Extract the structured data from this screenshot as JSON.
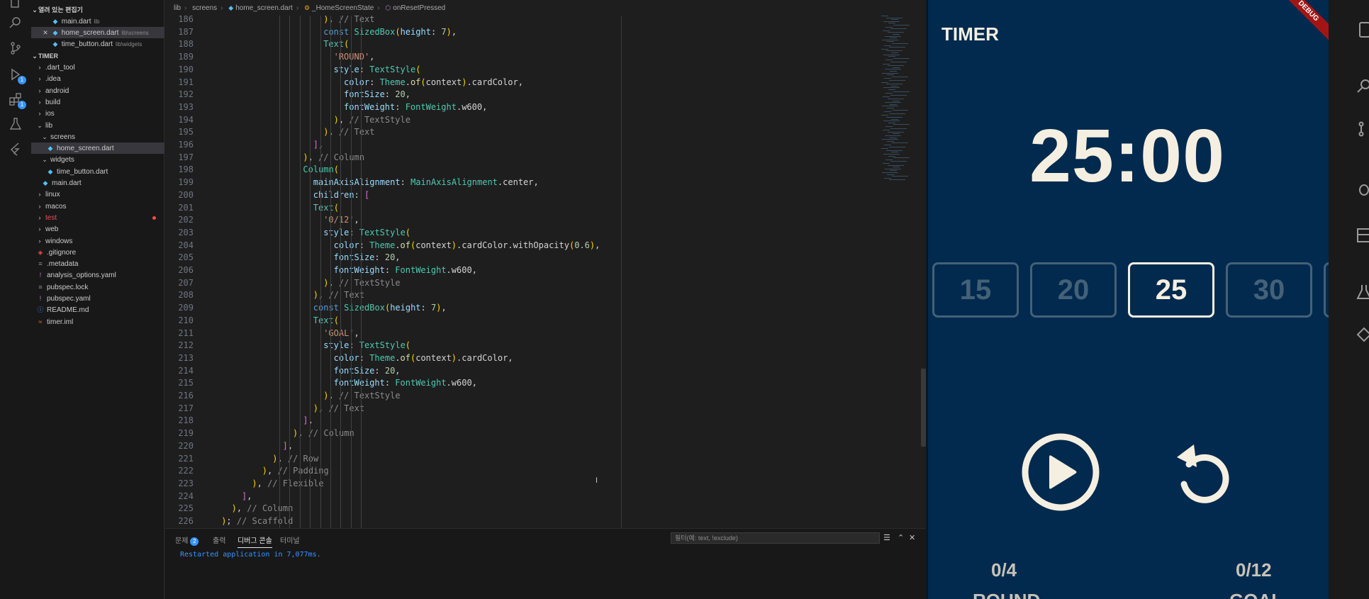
{
  "explorer": {
    "open_editors_title": "열려 있는 편집기",
    "open_editors": [
      {
        "name": "main.dart",
        "desc": "lib"
      },
      {
        "name": "home_screen.dart",
        "desc": "lib\\screens"
      },
      {
        "name": "time_button.dart",
        "desc": "lib\\widgets"
      }
    ],
    "project_title": "TIMER",
    "tree": [
      {
        "label": ".dart_tool",
        "kind": "folder",
        "depth": 1
      },
      {
        "label": ".idea",
        "kind": "folder",
        "depth": 1
      },
      {
        "label": "android",
        "kind": "folder",
        "depth": 1
      },
      {
        "label": "build",
        "kind": "folder",
        "depth": 1
      },
      {
        "label": "ios",
        "kind": "folder",
        "depth": 1
      },
      {
        "label": "lib",
        "kind": "folder-open",
        "depth": 1
      },
      {
        "label": "screens",
        "kind": "folder-open",
        "depth": 2
      },
      {
        "label": "home_screen.dart",
        "kind": "dart",
        "depth": 3
      },
      {
        "label": "widgets",
        "kind": "folder-open",
        "depth": 2
      },
      {
        "label": "time_button.dart",
        "kind": "dart",
        "depth": 3
      },
      {
        "label": "main.dart",
        "kind": "dart",
        "depth": 2
      },
      {
        "label": "linux",
        "kind": "folder",
        "depth": 1
      },
      {
        "label": "macos",
        "kind": "folder",
        "depth": 1
      },
      {
        "label": "test",
        "kind": "folder",
        "depth": 1
      },
      {
        "label": "web",
        "kind": "folder",
        "depth": 1
      },
      {
        "label": "windows",
        "kind": "folder",
        "depth": 1
      },
      {
        "label": ".gitignore",
        "kind": "git",
        "depth": 1
      },
      {
        "label": ".metadata",
        "kind": "file",
        "depth": 1
      },
      {
        "label": "analysis_options.yaml",
        "kind": "yaml",
        "depth": 1
      },
      {
        "label": "pubspec.lock",
        "kind": "file",
        "depth": 1
      },
      {
        "label": "pubspec.yaml",
        "kind": "yaml",
        "depth": 1
      },
      {
        "label": "README.md",
        "kind": "info",
        "depth": 1
      },
      {
        "label": "timer.iml",
        "kind": "xml",
        "depth": 1
      }
    ]
  },
  "breadcrumb": [
    "lib",
    "screens",
    "home_screen.dart",
    "_HomeScreenState",
    "onResetPressed"
  ],
  "code_lines": [
    {
      "n": "186",
      "text": "), // Text"
    },
    {
      "n": "187",
      "text": "const SizedBox(height: 7),"
    },
    {
      "n": "188",
      "text": "Text("
    },
    {
      "n": "189",
      "text": "'ROUND',"
    },
    {
      "n": "190",
      "text": "style: TextStyle("
    },
    {
      "n": "191",
      "text": "color: Theme.of(context).cardColor,"
    },
    {
      "n": "192",
      "text": "fontSize: 20,"
    },
    {
      "n": "193",
      "text": "fontWeight: FontWeight.w600,"
    },
    {
      "n": "194",
      "text": "), // TextStyle"
    },
    {
      "n": "195",
      "text": "), // Text"
    },
    {
      "n": "196",
      "text": "],"
    },
    {
      "n": "197",
      "text": "), // Column"
    },
    {
      "n": "198",
      "text": "Column("
    },
    {
      "n": "199",
      "text": "mainAxisAlignment: MainAxisAlignment.center,"
    },
    {
      "n": "200",
      "text": "children: ["
    },
    {
      "n": "201",
      "text": "Text("
    },
    {
      "n": "202",
      "text": "'0/12',"
    },
    {
      "n": "203",
      "text": "style: TextStyle("
    },
    {
      "n": "204",
      "text": "color: Theme.of(context).cardColor.withOpacity(0.6),"
    },
    {
      "n": "205",
      "text": "fontSize: 20,"
    },
    {
      "n": "206",
      "text": "fontWeight: FontWeight.w600,"
    },
    {
      "n": "207",
      "text": "), // TextStyle"
    },
    {
      "n": "208",
      "text": "), // Text"
    },
    {
      "n": "209",
      "text": "const SizedBox(height: 7),"
    },
    {
      "n": "210",
      "text": "Text("
    },
    {
      "n": "211",
      "text": "'GOAL',"
    },
    {
      "n": "212",
      "text": "style: TextStyle("
    },
    {
      "n": "213",
      "text": "color: Theme.of(context).cardColor,"
    },
    {
      "n": "214",
      "text": "fontSize: 20,"
    },
    {
      "n": "215",
      "text": "fontWeight: FontWeight.w600,"
    },
    {
      "n": "216",
      "text": "), // TextStyle"
    },
    {
      "n": "217",
      "text": "), // Text"
    },
    {
      "n": "218",
      "text": "],"
    },
    {
      "n": "219",
      "text": "), // Column"
    },
    {
      "n": "220",
      "text": "],"
    },
    {
      "n": "221",
      "text": "), // Row"
    },
    {
      "n": "222",
      "text": "), // Padding"
    },
    {
      "n": "223",
      "text": "), // Flexible"
    },
    {
      "n": "224",
      "text": "],"
    },
    {
      "n": "225",
      "text": "), // Column"
    },
    {
      "n": "226",
      "text": "); // Scaffold"
    }
  ],
  "panel": {
    "tabs": [
      {
        "label": "문제",
        "badge": "2"
      },
      {
        "label": "출력"
      },
      {
        "label": "디버그 콘솔"
      },
      {
        "label": "터미널"
      }
    ],
    "filter_placeholder": "필터(예: text, !exclude)",
    "console_output": "Restarted application in 7,077ms."
  },
  "app": {
    "title": "TIMER",
    "debug_banner": "DEBUG",
    "timer": "25:00",
    "time_options": [
      "15",
      "20",
      "25",
      "30"
    ],
    "selected_option": "25",
    "round_value": "0/4",
    "round_label": "ROUND",
    "goal_value": "0/12",
    "goal_label": "GOAL"
  },
  "colors": {
    "app_background": "#012a4e",
    "card_color": "#f5efe1",
    "debug_banner": "#a31515",
    "console_text": "#3794ff"
  }
}
